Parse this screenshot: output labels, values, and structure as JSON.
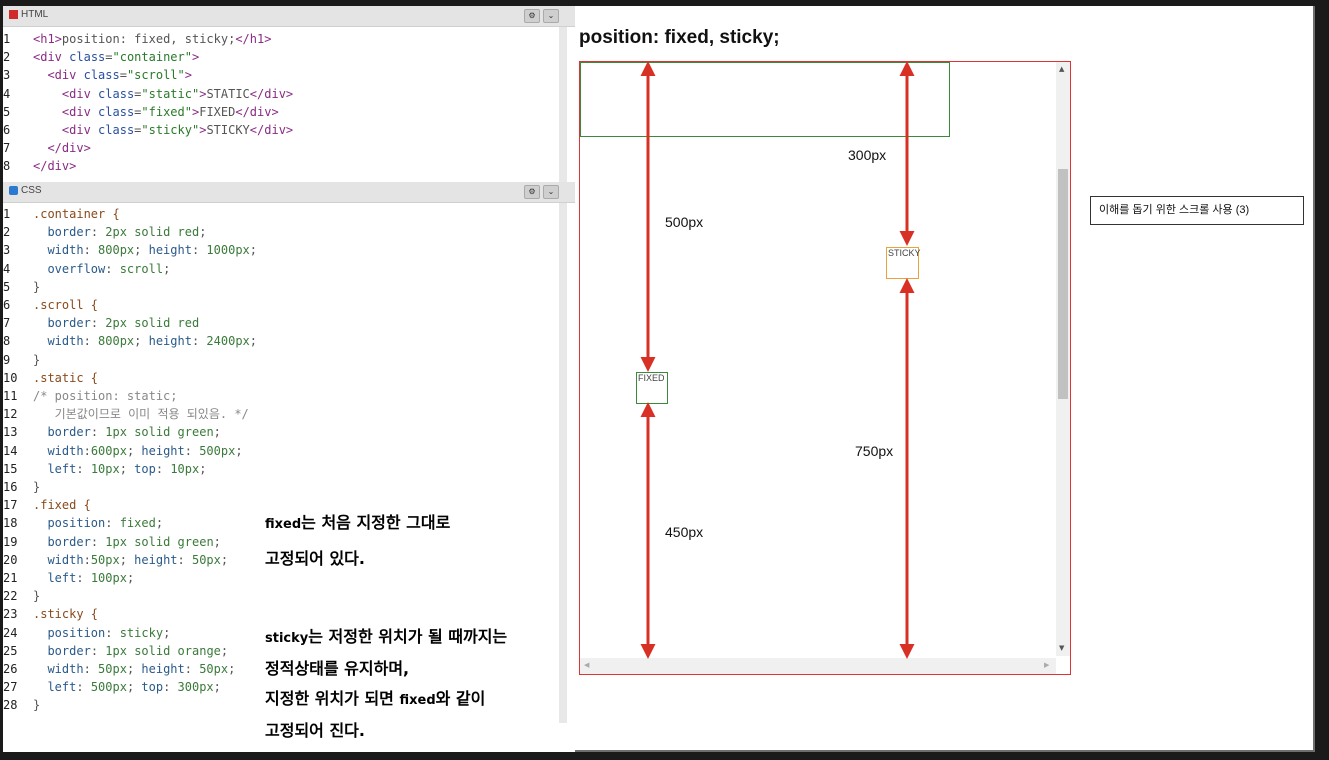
{
  "html_panel": {
    "title": "HTML",
    "lines": [
      [
        "1",
        "<h1>position: fixed, sticky;</h1>"
      ],
      [
        "2",
        "<div class=\"container\">"
      ],
      [
        "3",
        "  <div class=\"scroll\">"
      ],
      [
        "4",
        "    <div class=\"static\">STATIC</div>"
      ],
      [
        "5",
        "    <div class=\"fixed\">FIXED</div>"
      ],
      [
        "6",
        "    <div class=\"sticky\">STICKY</div>"
      ],
      [
        "7",
        "  </div>"
      ],
      [
        "8",
        "</div>"
      ]
    ]
  },
  "css_panel": {
    "title": "CSS",
    "lines": [
      [
        "1",
        ".container {"
      ],
      [
        "2",
        "  border: 2px solid red;"
      ],
      [
        "3",
        "  width: 800px; height: 1000px;"
      ],
      [
        "4",
        "  overflow: scroll;"
      ],
      [
        "5",
        "}"
      ],
      [
        "6",
        ".scroll {"
      ],
      [
        "7",
        "  border: 2px solid red"
      ],
      [
        "8",
        "  width: 800px; height: 2400px;"
      ],
      [
        "9",
        "}"
      ],
      [
        "10",
        ".static {"
      ],
      [
        "11",
        "/* position: static;"
      ],
      [
        "12",
        "   기본값이므로 이미 적용 되있음. */"
      ],
      [
        "13",
        "  border: 1px solid green;"
      ],
      [
        "14",
        "  width:600px; height: 500px;"
      ],
      [
        "15",
        "  left: 10px; top: 10px;"
      ],
      [
        "16",
        "}"
      ],
      [
        "17",
        ".fixed {"
      ],
      [
        "18",
        "  position: fixed;"
      ],
      [
        "19",
        "  border: 1px solid green;"
      ],
      [
        "20",
        "  width:50px; height: 50px;"
      ],
      [
        "21",
        "  left: 100px;"
      ],
      [
        "22",
        "}"
      ],
      [
        "23",
        ".sticky {"
      ],
      [
        "24",
        "  position: sticky;"
      ],
      [
        "25",
        "  border: 1px solid orange;"
      ],
      [
        "26",
        "  width: 50px; height: 50px;"
      ],
      [
        "27",
        "  left: 500px; top: 300px;"
      ],
      [
        "28",
        "}"
      ]
    ]
  },
  "notes": {
    "fixed_line1_en": "fixed",
    "fixed_line1_ko": "는 처음 지정한 그대로",
    "fixed_line2": "고정되어 있다.",
    "sticky_line1_en": "sticky",
    "sticky_line1_ko": "는 저정한 위치가 될 때까지는",
    "sticky_line2": "정적상태를 유지하며,",
    "sticky_line3_pre": "지정한 위치가 되면 ",
    "sticky_line3_en": "fixed",
    "sticky_line3_post": "와 같이",
    "sticky_line4": "고정되어 진다."
  },
  "preview": {
    "title": "position: fixed, sticky;",
    "fixed_label": "FIXED",
    "sticky_label": "STICKY",
    "dim_500": "500px",
    "dim_450": "450px",
    "dim_300": "300px",
    "dim_750": "750px"
  },
  "side_note": "이해를 돕기 위한 스크롤 사용 (3)",
  "colors": {
    "arrow": "#d93025",
    "container_border": "#dd3333",
    "static_border": "#3a8a3a",
    "sticky_border": "#e8a33a"
  }
}
